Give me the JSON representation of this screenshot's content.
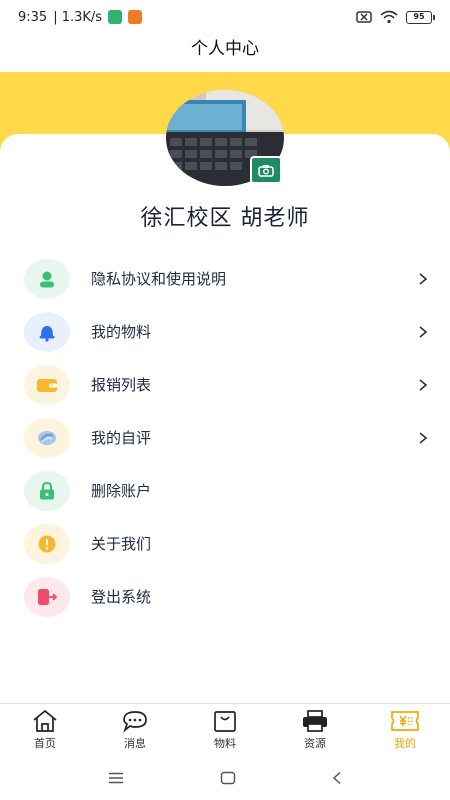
{
  "status_bar": {
    "time": "9:35",
    "speed": "| 1.3K/s",
    "battery": "95"
  },
  "header": {
    "title": "个人中心"
  },
  "profile": {
    "name": "徐汇校区 胡老师"
  },
  "menu": [
    {
      "label": "隐私协议和使用说明",
      "icon": "user-icon",
      "color": "#3dbe78",
      "bg": "#e7f7ee",
      "arrow": true
    },
    {
      "label": "我的物料",
      "icon": "bell-icon",
      "color": "#2f6df5",
      "bg": "#e8effd",
      "arrow": true
    },
    {
      "label": "报销列表",
      "icon": "wallet-icon",
      "color": "#f5b82e",
      "bg": "#fdf4de",
      "arrow": true
    },
    {
      "label": "我的自评",
      "icon": "self-review-icon",
      "color": "#7fa8e8",
      "bg": "#fdf4de",
      "arrow": true
    },
    {
      "label": "删除账户",
      "icon": "lock-icon",
      "color": "#3dbe78",
      "bg": "#e7f7ee",
      "arrow": false
    },
    {
      "label": "关于我们",
      "icon": "info-icon",
      "color": "#f5b82e",
      "bg": "#fdf4de",
      "arrow": false
    },
    {
      "label": "登出系统",
      "icon": "logout-icon",
      "color": "#f04b6a",
      "bg": "#fde8ec",
      "arrow": false
    }
  ],
  "tabbar": [
    {
      "label": "首页",
      "icon": "home-icon"
    },
    {
      "label": "消息",
      "icon": "message-icon"
    },
    {
      "label": "物料",
      "icon": "shopping-bag-icon"
    },
    {
      "label": "资源",
      "icon": "printer-icon"
    },
    {
      "label": "我的",
      "icon": "yen-ticket-icon",
      "active": true
    }
  ],
  "colors": {
    "accent_yellow": "#ffd94a",
    "active_tab": "#f2a900",
    "camera_badge": "#1f8a63"
  }
}
